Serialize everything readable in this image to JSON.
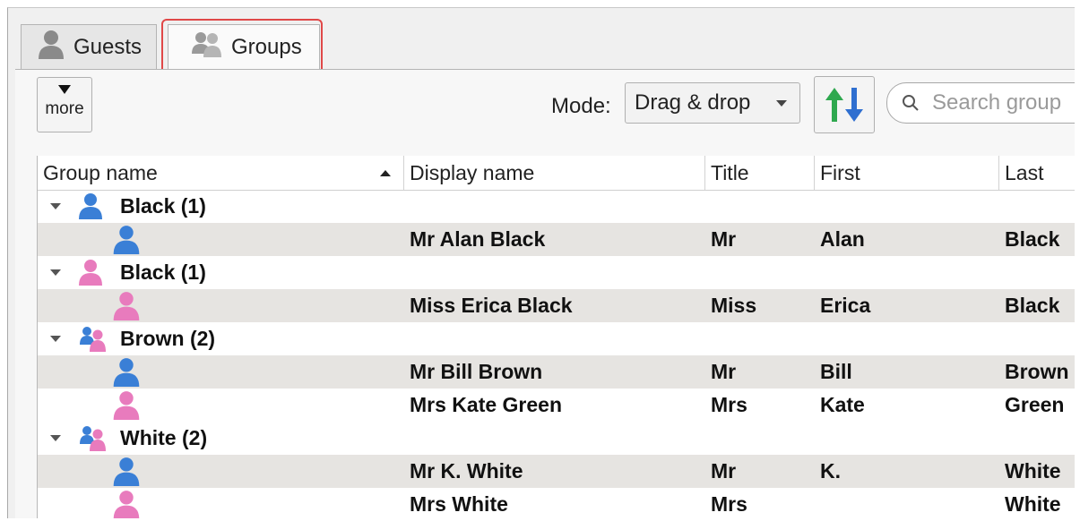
{
  "tabs": [
    {
      "label": "Guests",
      "icon": "person-icon"
    },
    {
      "label": "Groups",
      "icon": "group-icon",
      "selected": true
    }
  ],
  "toolbar": {
    "more_label": "more",
    "mode_label": "Mode:",
    "mode_value": "Drag & drop",
    "search_placeholder": "Search group"
  },
  "columns": [
    "Group name",
    "Display name",
    "Title",
    "First",
    "Last"
  ],
  "sort": {
    "column": "Group name",
    "direction": "ascending"
  },
  "colors": {
    "male": "#3a7fd6",
    "female": "#e87bbd",
    "highlight": "#e04848",
    "alt_row": "#e6e4e1"
  },
  "groups": [
    {
      "name": "Black (1)",
      "icon": "male",
      "members": [
        {
          "icon": "male",
          "display": "Mr Alan Black",
          "title": "Mr",
          "first": "Alan",
          "last": "Black"
        }
      ]
    },
    {
      "name": "Black (1)",
      "icon": "female",
      "members": [
        {
          "icon": "female",
          "display": "Miss Erica Black",
          "title": "Miss",
          "first": "Erica",
          "last": "Black"
        }
      ]
    },
    {
      "name": "Brown (2)",
      "icon": "couple",
      "members": [
        {
          "icon": "male",
          "display": "Mr Bill Brown",
          "title": "Mr",
          "first": "Bill",
          "last": "Brown"
        },
        {
          "icon": "female",
          "display": "Mrs Kate Green",
          "title": "Mrs",
          "first": "Kate",
          "last": "Green"
        }
      ]
    },
    {
      "name": "White (2)",
      "icon": "couple",
      "members": [
        {
          "icon": "male",
          "display": "Mr K. White",
          "title": "Mr",
          "first": "K.",
          "last": "White"
        },
        {
          "icon": "female",
          "display": "Mrs White",
          "title": "Mrs",
          "first": "",
          "last": "White"
        }
      ]
    }
  ]
}
